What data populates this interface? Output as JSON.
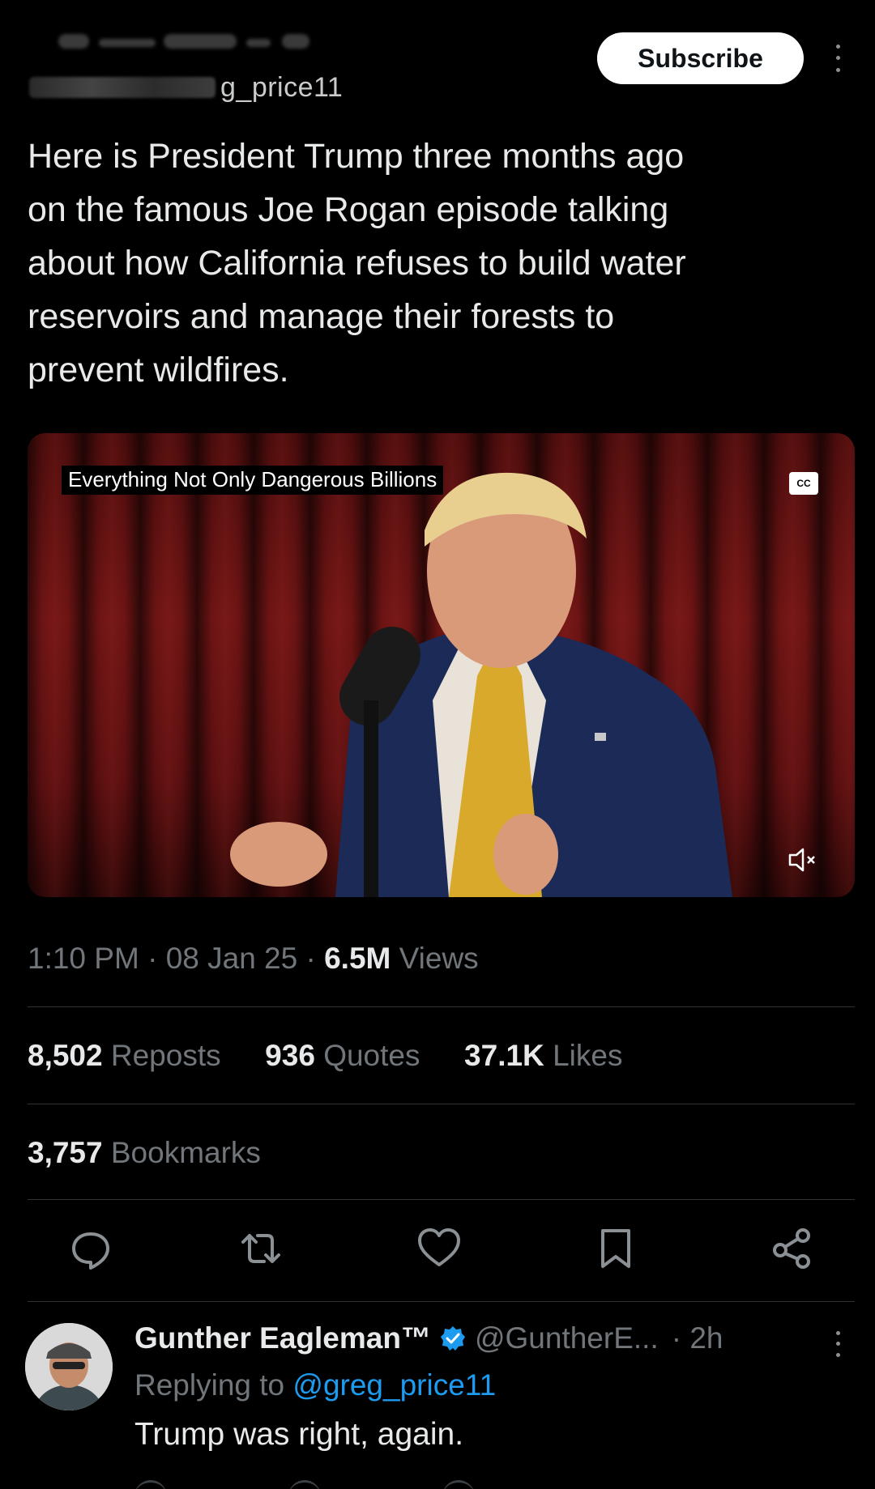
{
  "header": {
    "handle_suffix": "g_price11",
    "subscribe_label": "Subscribe"
  },
  "tweet": {
    "text": "Here is President Trump three months ago\non the famous Joe Rogan episode talking\nabout how California refuses to build water\nreservoirs and manage their forests to\nprevent wildfires."
  },
  "video": {
    "caption": "Everything Not Only Dangerous Billions",
    "cc_label": "CC",
    "background_color": "#5a0f10"
  },
  "meta": {
    "time": "1:10 PM",
    "separator": "·",
    "date": "08 Jan 25",
    "views_count": "6.5M",
    "views_label": "Views"
  },
  "stats": {
    "reposts_count": "8,502",
    "reposts_label": "Reposts",
    "quotes_count": "936",
    "quotes_label": "Quotes",
    "likes_count": "37.1K",
    "likes_label": "Likes",
    "bookmarks_count": "3,757",
    "bookmarks_label": "Bookmarks"
  },
  "actions": {
    "icons": [
      "reply-icon",
      "repost-icon",
      "like-icon",
      "bookmark-icon",
      "share-icon"
    ]
  },
  "reply": {
    "name": "Gunther Eagleman™",
    "handle": "@GuntherE...",
    "time": "· 2h",
    "replying_prefix": "Replying to",
    "replying_handle": "@greg_price11",
    "text": "Trump was right,  again."
  },
  "colors": {
    "background": "#000000",
    "text_primary": "#e7e9ea",
    "text_secondary": "#71767b",
    "accent": "#1d9bf0",
    "divider": "#2f3336"
  }
}
